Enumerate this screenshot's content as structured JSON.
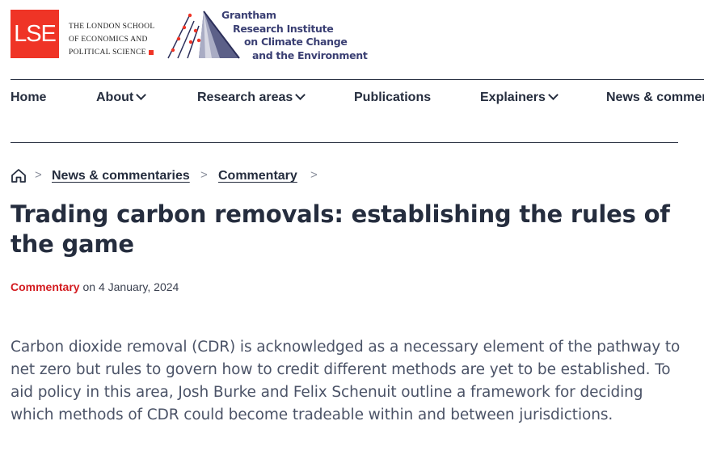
{
  "logos": {
    "lse_mark": "LSE",
    "lse_name_lines": [
      "THE LONDON SCHOOL",
      "OF ECONOMICS AND",
      "POLITICAL SCIENCE"
    ],
    "grantham_lines": [
      "Grantham",
      "Research Institute",
      "on Climate Change",
      "and the Environment"
    ]
  },
  "nav": {
    "items": [
      {
        "label": "Home",
        "has_dropdown": false
      },
      {
        "label": "About",
        "has_dropdown": true
      },
      {
        "label": "Research areas",
        "has_dropdown": true
      },
      {
        "label": "Publications",
        "has_dropdown": false
      },
      {
        "label": "Explainers",
        "has_dropdown": true
      },
      {
        "label": "News & commer",
        "has_dropdown": false
      }
    ]
  },
  "breadcrumb": {
    "home_icon": "home-icon",
    "items": [
      "News & commentaries",
      "Commentary"
    ]
  },
  "article": {
    "title": "Trading carbon removals: establishing the rules of the game",
    "category": "Commentary",
    "date_text": "on 4 January, 2024",
    "lead": "Carbon dioxide removal (CDR) is acknowledged as a necessary element of the pathway to net zero but rules to govern how to credit different methods are yet to be established. To aid policy in this area, Josh Burke and Felix Schenuit outline a framework for deciding which methods of CDR could become tradeable within and between jurisdictions."
  },
  "colors": {
    "lse_red": "#ef3426",
    "text_dark": "#252d3e",
    "grantham_navy": "#3a3f73",
    "category_red": "#d31a1f"
  }
}
